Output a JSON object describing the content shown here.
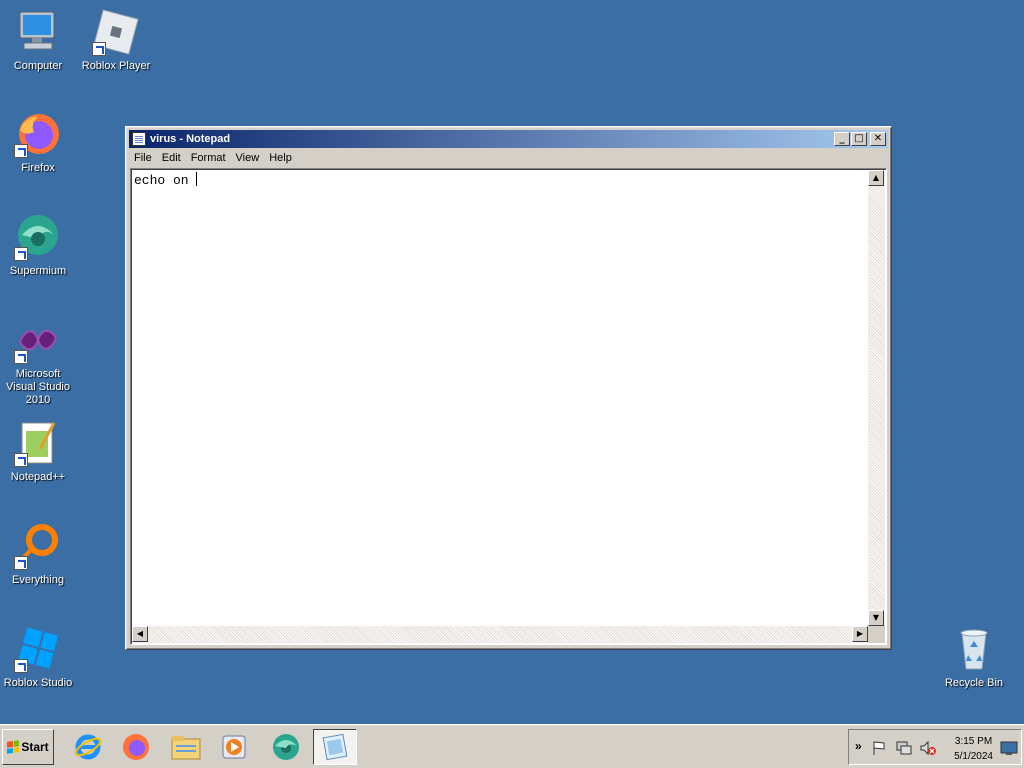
{
  "desktop": {
    "icons": [
      {
        "label": "Computer"
      },
      {
        "label": "Roblox Player"
      },
      {
        "label": "Firefox"
      },
      {
        "label": "Supermium"
      },
      {
        "label": "Microsoft Visual Studio 2010"
      },
      {
        "label": "Notepad++"
      },
      {
        "label": "Everything"
      },
      {
        "label": "Roblox Studio"
      },
      {
        "label": "Recycle Bin"
      }
    ]
  },
  "window": {
    "title": "virus - Notepad",
    "menu": [
      "File",
      "Edit",
      "Format",
      "View",
      "Help"
    ],
    "content": "echo on "
  },
  "taskbar": {
    "start_label": "Start",
    "pinned": [
      "internet-explorer-icon",
      "firefox-icon",
      "file-explorer-icon",
      "media-player-icon",
      "supermium-icon",
      "notepad-icon"
    ],
    "clock_time": "3:15 PM",
    "clock_date": "5/1/2024"
  },
  "colors": {
    "desktop_bg": "#3a6ea5",
    "titlebar_start": "#0a246a",
    "titlebar_end": "#a6caf0",
    "chrome": "#d4d0c8"
  }
}
